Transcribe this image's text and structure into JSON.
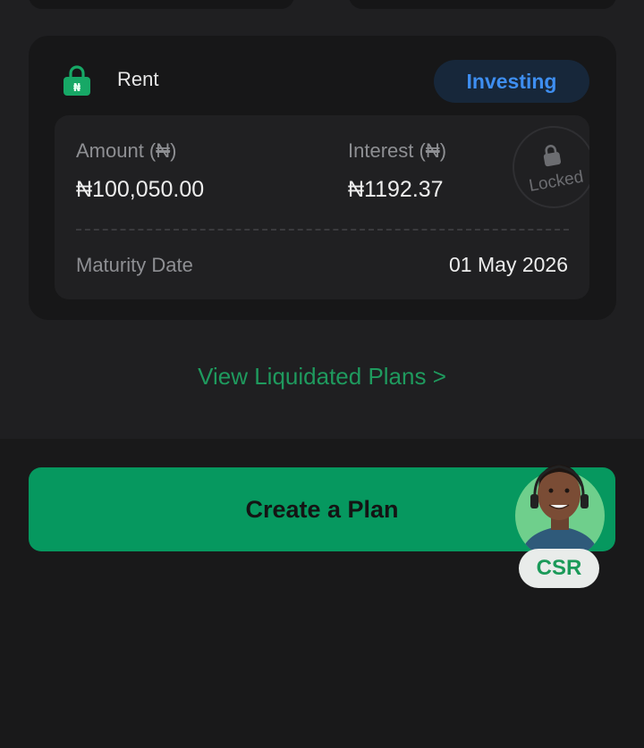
{
  "plan": {
    "name": "Rent",
    "status": "Investing",
    "amount_label_prefix": "Amount (",
    "currency_symbol": "₦",
    "label_suffix": ")",
    "amount_value": "₦100,050.00",
    "interest_label_prefix": "Interest (",
    "interest_value": "₦1192.37",
    "locked_text": "Locked",
    "maturity_label": "Maturity Date",
    "maturity_value": "01 May 2026"
  },
  "links": {
    "view_liquidated": "View Liquidated Plans >"
  },
  "actions": {
    "create_plan": "Create a Plan"
  },
  "support": {
    "csr_label": "CSR"
  },
  "colors": {
    "accent_green": "#06985f",
    "status_blue": "#3e8ef0",
    "background": "#1f1f21"
  },
  "icons": {
    "plan_icon": "naira-lock-icon",
    "stamp_icon": "padlock-icon"
  }
}
